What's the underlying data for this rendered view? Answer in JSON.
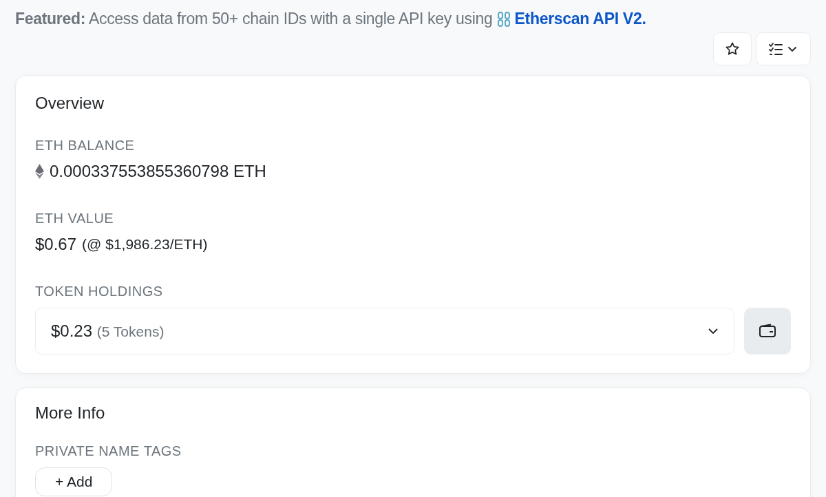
{
  "featured": {
    "text": "**Featured:** Access data from 50+ chain IDs with a single API key using",
    "link": "Etherscan API V2."
  },
  "toolbar": {
    "favorite": false
  },
  "overview": {
    "title": "Overview",
    "eth_balance": {
      "label": "ETH BALANCE",
      "value": "0.000337553855360798 ETH"
    },
    "eth_value": {
      "label": "ETH VALUE",
      "value": "$0.67",
      "rate": "(@ $1,986.23/ETH)"
    },
    "token_holdings": {
      "label": "TOKEN HOLDINGS",
      "value": "$0.23",
      "count": "(5 Tokens)"
    }
  },
  "more_info": {
    "title": "More Info",
    "label": "PRIVATE NAME TAGS",
    "button": "+ Add"
  }
}
